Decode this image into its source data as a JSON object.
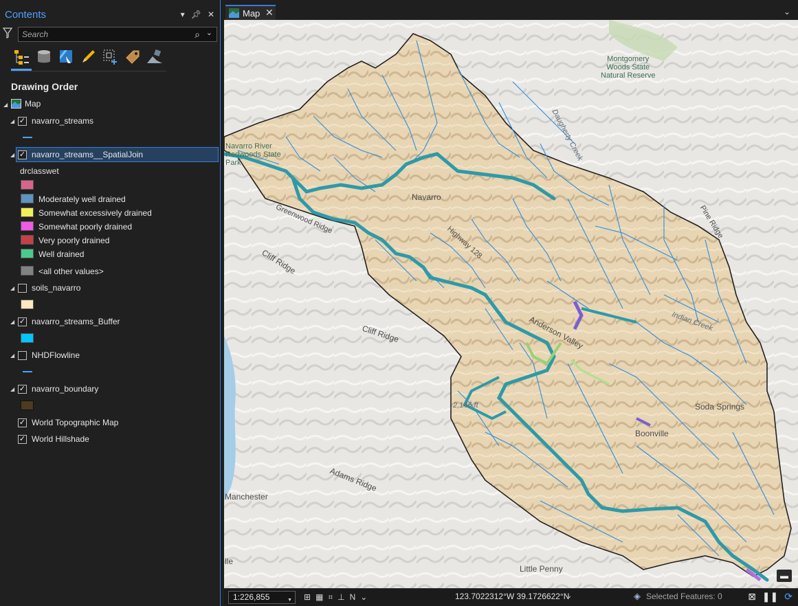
{
  "contents": {
    "title": "Contents",
    "search_placeholder": "Search",
    "drawing_order": "Drawing Order",
    "map_item": "Map",
    "layers": {
      "streams": "navarro_streams",
      "spatial_join": "navarro_streams__SpatialJoin",
      "field": "drclasswet",
      "legend": [
        {
          "label": "",
          "color": "#d9648a"
        },
        {
          "label": "Moderately well drained",
          "color": "#5d94c2"
        },
        {
          "label": "Somewhat excessively drained",
          "color": "#f0f059"
        },
        {
          "label": "Somewhat poorly drained",
          "color": "#ef5ae6"
        },
        {
          "label": "Very poorly drained",
          "color": "#c44146"
        },
        {
          "label": "Well drained",
          "color": "#4acb8d"
        },
        {
          "label": "<all other values>",
          "color": "#828282"
        }
      ],
      "soils": "soils_navarro",
      "soils_color": "#fde8bf",
      "buffer": "navarro_streams_Buffer",
      "buffer_color": "#00c5ff",
      "nhd": "NHDFlowline",
      "boundary": "navarro_boundary",
      "boundary_color": "#4e3b1f",
      "topo": "World Topographic Map",
      "hillshade": "World Hillshade"
    }
  },
  "map_tab": {
    "label": "Map"
  },
  "map_labels": {
    "montgomery": "Montgomery\nWoods State\nNatural Reserve",
    "daugherty": "Daugherty Creek",
    "navarro_river": "Navarro River\nRedwoods State\nPark",
    "navarro": "Navarro",
    "greenwood": "Greenwood Ridge",
    "cliff1": "Cliff Ridge",
    "cliff2": "Cliff Ridge",
    "highway": "Highway 128",
    "anderson": "Anderson Valley",
    "pine": "Pine Ridge",
    "indian": "Indian Creek",
    "soda": "Soda Springs",
    "boonville": "Boonville",
    "elev": "2,146 ft",
    "adams": "Adams Ridge",
    "manchester": "Manchester",
    "elk": "lle",
    "little_penny": "Little Penny"
  },
  "status": {
    "scale": "1:226,855",
    "coords": "123.7022312°W 39.1726622°N",
    "selected": "Selected Features: 0"
  }
}
